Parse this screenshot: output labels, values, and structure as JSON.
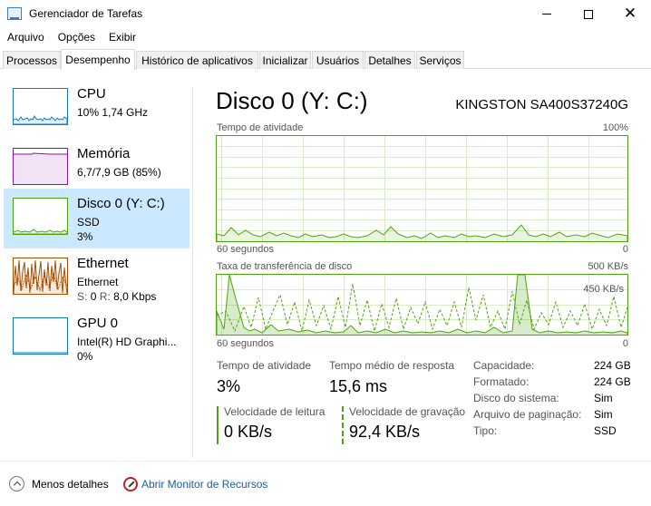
{
  "window": {
    "title": "Gerenciador de Tarefas"
  },
  "menu": [
    "Arquivo",
    "Opções",
    "Exibir"
  ],
  "tabs": [
    "Processos",
    "Desempenho",
    "Histórico de aplicativos",
    "Inicializar",
    "Usuários",
    "Detalhes",
    "Serviços"
  ],
  "sidebar": {
    "cpu": {
      "name": "CPU",
      "sub1": "10% 1,74 GHz"
    },
    "memory": {
      "name": "Memória",
      "sub1": "6,7/7,9 GB (85%)"
    },
    "disk": {
      "name": "Disco 0 (Y: C:)",
      "sub1": "SSD",
      "sub2": "3%"
    },
    "ethernet": {
      "name": "Ethernet",
      "sub1": "Ethernet",
      "send_prefix": "S:",
      "send_value": "0",
      "recv_prefix": "R:",
      "recv_value": "8,0 Kbps"
    },
    "gpu": {
      "name": "GPU 0",
      "sub1": "Intel(R) HD Graphi...",
      "sub2": "0%"
    }
  },
  "detail": {
    "title": "Disco 0 (Y: C:)",
    "model": "KINGSTON SA400S37240G",
    "activity_graph": {
      "label": "Tempo de atividade",
      "max_label": "100%",
      "x_label": "60 segundos",
      "min_label": "0"
    },
    "transfer_graph": {
      "label": "Taxa de transferência de disco",
      "max_label": "500 KB/s",
      "mid_label": "450 KB/s",
      "x_label": "60 segundos",
      "min_label": "0"
    },
    "stats": {
      "active_time_label": "Tempo de atividade",
      "active_time_value": "3%",
      "response_label": "Tempo médio de resposta",
      "response_value": "15,6 ms",
      "read_label": "Velocidade de leitura",
      "read_value": "0 KB/s",
      "write_label": "Velocidade de gravação",
      "write_value": "92,4 KB/s"
    },
    "properties": [
      {
        "key": "Capacidade:",
        "value": "224 GB"
      },
      {
        "key": "Formatado:",
        "value": "224 GB"
      },
      {
        "key": "Disco do sistema:",
        "value": "Sim"
      },
      {
        "key": "Arquivo de paginação:",
        "value": "Sim"
      },
      {
        "key": "Tipo:",
        "value": "SSD"
      }
    ]
  },
  "footer": {
    "less_details": "Menos detalhes",
    "resource_monitor": "Abrir Monitor de Recursos"
  },
  "colors": {
    "disk_green": "#4da60c",
    "cpu_blue": "#117dbb",
    "memory_purple": "#8b12ae",
    "ethernet_orange": "#a74f01",
    "selected_bg": "#cce8ff"
  },
  "icons": {
    "app": "task-manager-icon",
    "minimize": "minimize-icon",
    "maximize": "maximize-icon",
    "close": "close-icon",
    "less": "chevron-up-icon",
    "monitor": "resource-monitor-icon"
  }
}
